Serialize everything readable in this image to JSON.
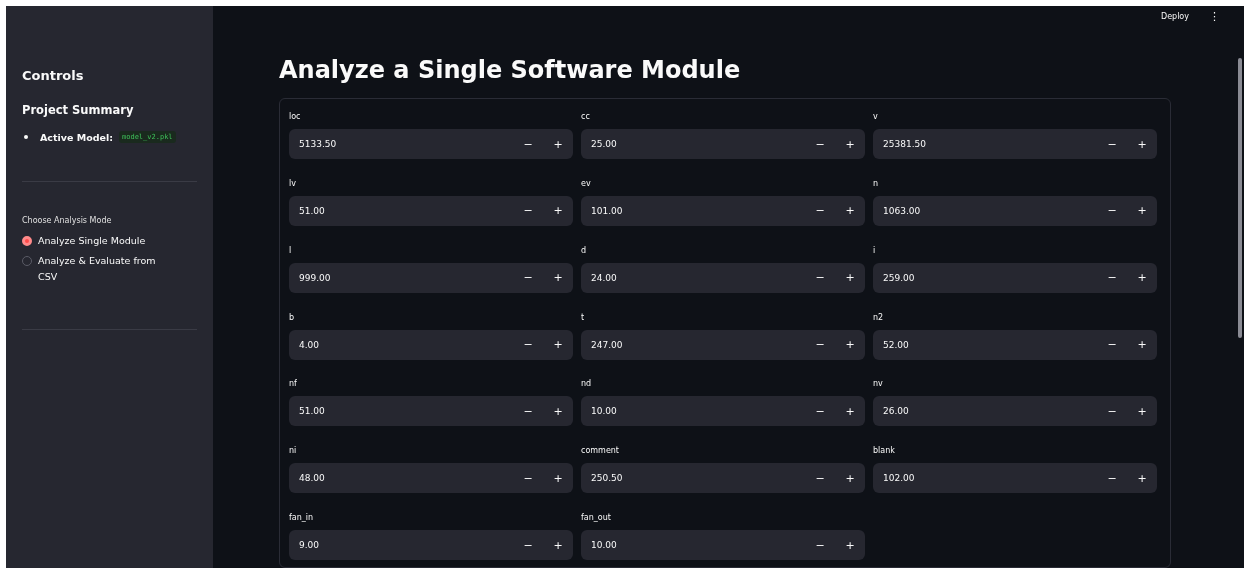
{
  "header": {
    "deploy": "Deploy",
    "menu": "⋮"
  },
  "sidebar": {
    "title": "Controls",
    "section": "Project Summary",
    "summary": [
      {
        "label": "Active Model:",
        "value": "model_v2.pkl"
      }
    ],
    "mode": {
      "label": "Choose Analysis Mode",
      "options": [
        {
          "label": "Analyze Single Module",
          "selected": true
        },
        {
          "label": "Analyze & Evaluate from CSV",
          "selected": false
        }
      ]
    }
  },
  "main": {
    "title": "Analyze a Single Software Module",
    "fields": [
      {
        "label": "loc",
        "value": "5133.50"
      },
      {
        "label": "cc",
        "value": "25.00"
      },
      {
        "label": "v",
        "value": "25381.50"
      },
      {
        "label": "lv",
        "value": "51.00"
      },
      {
        "label": "ev",
        "value": "101.00"
      },
      {
        "label": "n",
        "value": "1063.00"
      },
      {
        "label": "l",
        "value": "999.00"
      },
      {
        "label": "d",
        "value": "24.00"
      },
      {
        "label": "i",
        "value": "259.00"
      },
      {
        "label": "b",
        "value": "4.00"
      },
      {
        "label": "t",
        "value": "247.00"
      },
      {
        "label": "n2",
        "value": "52.00"
      },
      {
        "label": "nf",
        "value": "51.00"
      },
      {
        "label": "nd",
        "value": "10.00"
      },
      {
        "label": "nv",
        "value": "26.00"
      },
      {
        "label": "ni",
        "value": "48.00"
      },
      {
        "label": "comment",
        "value": "250.50"
      },
      {
        "label": "blank",
        "value": "102.00"
      },
      {
        "label": "fan_in",
        "value": "9.00"
      },
      {
        "label": "fan_out",
        "value": "10.00"
      }
    ],
    "stepper": {
      "minus": "−",
      "plus": "+"
    }
  }
}
